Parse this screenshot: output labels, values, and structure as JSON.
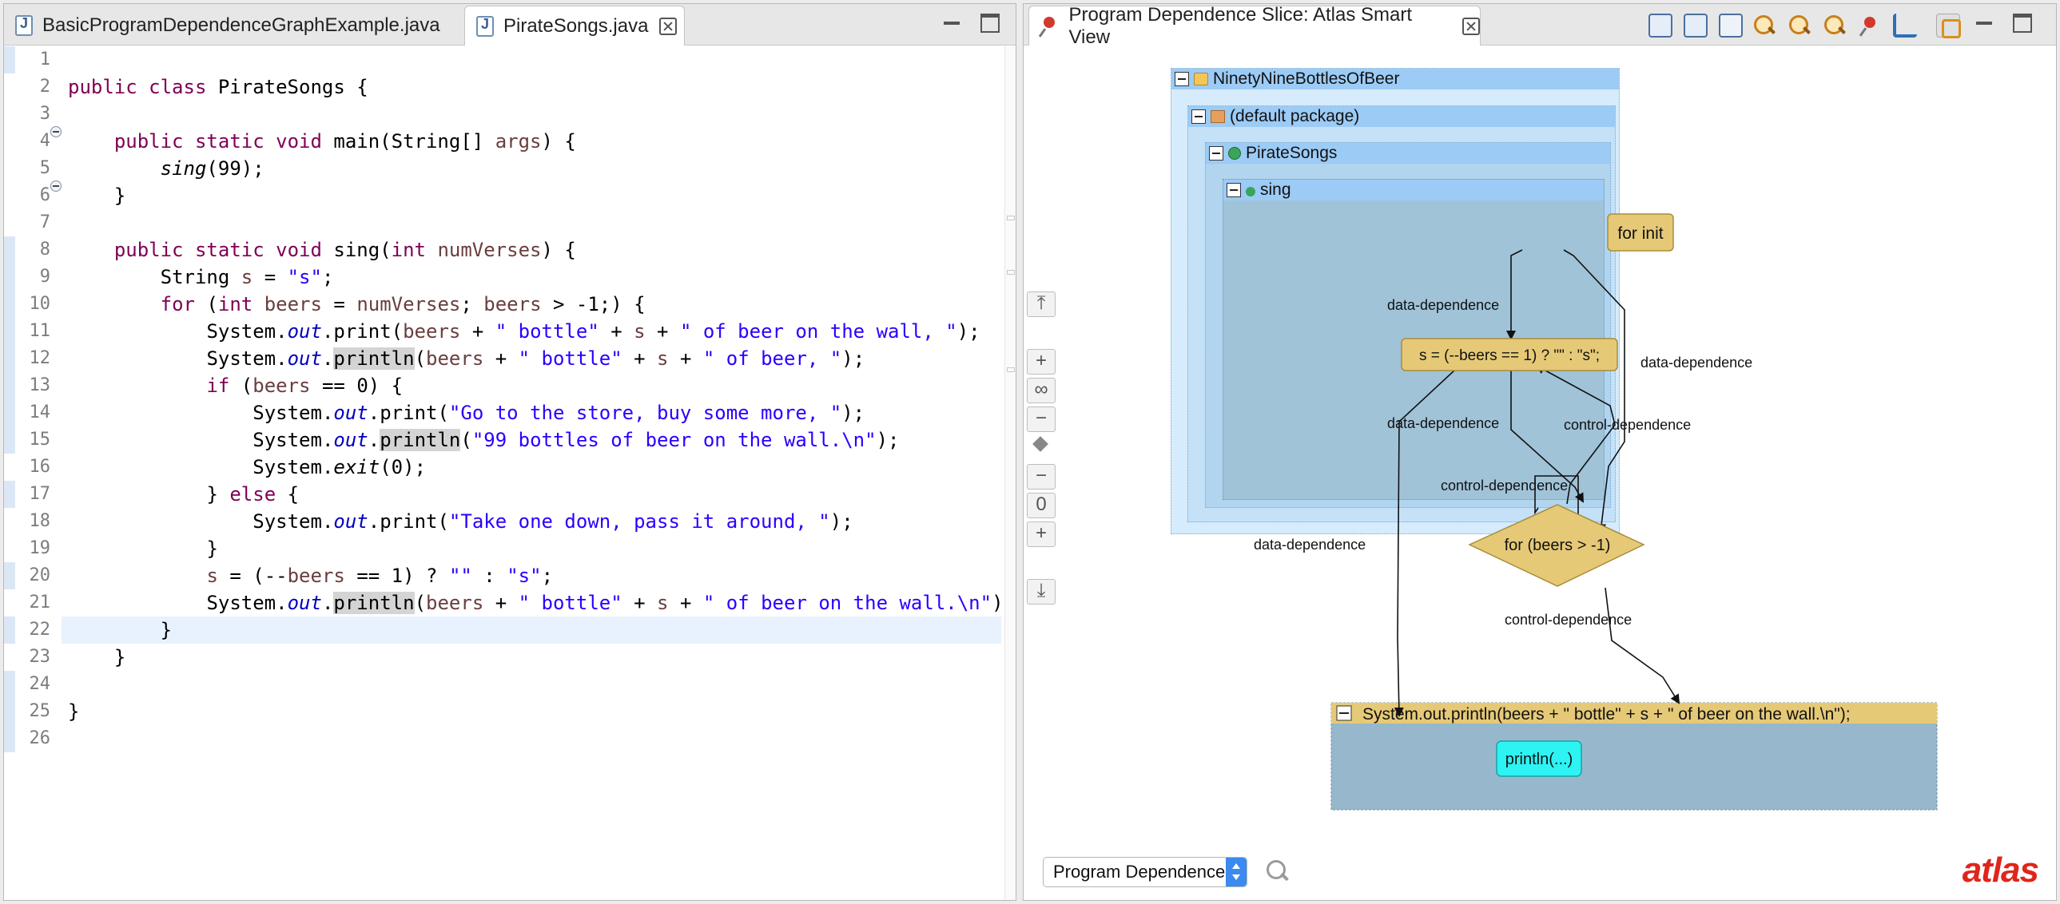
{
  "editor": {
    "tabs": [
      {
        "label": "BasicProgramDependenceGraphExample.java",
        "active": false
      },
      {
        "label": "PirateSongs.java",
        "active": true
      }
    ],
    "line_numbers": [
      "1",
      "2",
      "3",
      "4",
      "5",
      "6",
      "7",
      "8",
      "9",
      "10",
      "11",
      "12",
      "13",
      "14",
      "15",
      "16",
      "17",
      "18",
      "19",
      "20",
      "21",
      "22",
      "23",
      "24",
      "25",
      "26"
    ],
    "code_lines": [
      "",
      "public class PirateSongs {",
      "",
      "    public static void main(String[] args) {",
      "        sing(99);",
      "    }",
      "",
      "    public static void sing(int numVerses) {",
      "        String s = \"s\";",
      "        for (int beers = numVerses; beers > -1;) {",
      "            System.out.print(beers + \" bottle\" + s + \" of beer on the wall, \");",
      "            System.out.println(beers + \" bottle\" + s + \" of beer, \");",
      "            if (beers == 0) {",
      "                System.out.print(\"Go to the store, buy some more, \");",
      "                System.out.println(\"99 bottles of beer on the wall.\\n\");",
      "                System.exit(0);",
      "            } else {",
      "                System.out.print(\"Take one down, pass it around, \");",
      "            }",
      "            s = (--beers == 1) ? \"\" : \"s\";",
      "            System.out.println(beers + \" bottle\" + s + \" of beer on the wall.\\n\");",
      "        }",
      "    }",
      "",
      "}",
      ""
    ],
    "current_line": 21
  },
  "view": {
    "title": "Program Dependence Slice: Atlas Smart View",
    "toolbar_icons": [
      "hierarchy-icon",
      "layout-icon",
      "fit-icon",
      "zoom-out-icon",
      "zoom-in-icon",
      "zoom-reset-icon",
      "pin-icon",
      "export-icon",
      "link-editor-icon",
      "minimize-icon",
      "maximize-icon"
    ],
    "side_tools": [
      "collapse-top",
      "+",
      "∞",
      "−",
      "◆",
      "−",
      "0",
      "+",
      "collapse-bottom"
    ],
    "containers": {
      "project": "NinetyNineBottlesOfBeer",
      "package": "(default package)",
      "class": "PirateSongs",
      "method": "sing"
    },
    "nodes": {
      "for_init": "for init",
      "s_assign": "s = (--beers == 1) ? \"\" : \"s\";",
      "for_cond": "for (beers > -1)",
      "println_stmt": "System.out.println(beers + \" bottle\" + s + \" of beer on the wall.\\n\");",
      "println_call": "println(...)"
    },
    "edge_labels": {
      "e1": "data-dependence",
      "e2": "data-dependence",
      "e3": "data-dependence",
      "e4": "control-dependence",
      "e5": "control-dependence",
      "e6": "data-dependence",
      "e7": "control-dependence"
    },
    "colors": {
      "container_header": "#9ccbf5",
      "node_fill": "#e6c977",
      "call_node_fill": "#2ef3f3",
      "method_bg": "#a0c3d8"
    },
    "combo_value": "Program Dependence",
    "logo": "atlas"
  }
}
